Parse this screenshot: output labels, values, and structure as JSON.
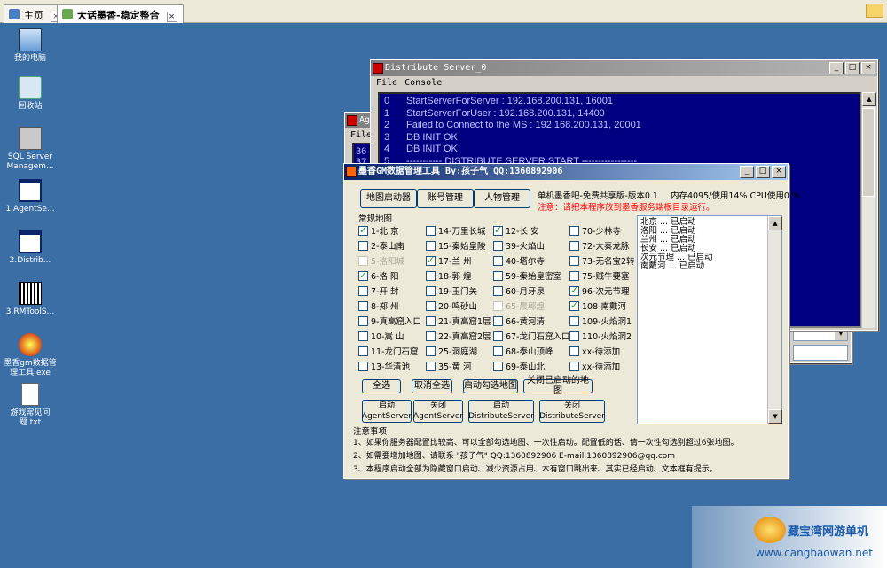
{
  "browser": {
    "tabs": [
      {
        "label": "主页"
      },
      {
        "label": "大话墨香-稳定整合"
      }
    ]
  },
  "desktop": {
    "icons": [
      {
        "label": "我的电脑"
      },
      {
        "label": "回收站"
      },
      {
        "label": "SQL Server Managem..."
      },
      {
        "label": "1.AgentSe..."
      },
      {
        "label": "2.Distrib..."
      },
      {
        "label": "3.RMToolS..."
      },
      {
        "label": "墨香gm数据管理工具.exe"
      },
      {
        "label": "游戏常见问题.txt"
      }
    ]
  },
  "distribute_window": {
    "title": "Distribute Server_0",
    "menu": [
      "File",
      "Console"
    ],
    "lines": [
      {
        "n": "0",
        "text": "StartServerForServer : 192.168.200.131, 16001"
      },
      {
        "n": "1",
        "text": "StartServerForUser : 192.168.200.131, 14400"
      },
      {
        "n": "2",
        "text": "Failed to Connect to the MS : 192.168.200.131, 20001"
      },
      {
        "n": "3",
        "text": "DB INIT OK"
      },
      {
        "n": "4",
        "text": "DB INIT OK"
      },
      {
        "n": "5",
        "text": "-----------   DISTRIBUTE SERVER START   -----------------"
      }
    ]
  },
  "agent_window": {
    "title": "Ag",
    "menu": [
      "File"
    ],
    "lines": [
      "36",
      "37"
    ]
  },
  "tool_window": {
    "title": "墨香GM数据管理工具 By:孩子气 QQ:1360892906",
    "top_buttons": [
      "地图启动器",
      "账号管理",
      "人物管理"
    ],
    "version": "单机墨香吧-免费共享版-版本0.1",
    "mem": "内存4095/使用14% CPU使用0 %",
    "notice": "注意：请把本程序放到墨香服务端根目录运行。",
    "group_label": "常规地图",
    "maps": [
      [
        {
          "label": "1-北 京",
          "checked": true
        },
        {
          "label": "14-万里长城",
          "checked": false
        },
        {
          "label": "12-长 安",
          "checked": true
        },
        {
          "label": "70-少林寺",
          "checked": false
        }
      ],
      [
        {
          "label": "2-泰山南",
          "checked": false
        },
        {
          "label": "15-秦始皇陵",
          "checked": false
        },
        {
          "label": "39-火焰山",
          "checked": false
        },
        {
          "label": "72-大秦龙脉",
          "checked": false
        }
      ],
      [
        {
          "label": "5-洛阳城",
          "checked": false,
          "disabled": true
        },
        {
          "label": "17-兰 州",
          "checked": true
        },
        {
          "label": "40-塔尔寺",
          "checked": false
        },
        {
          "label": "73-无名宝2转",
          "checked": false
        }
      ],
      [
        {
          "label": "6-洛 阳",
          "checked": true
        },
        {
          "label": "18-郭 煌",
          "checked": false
        },
        {
          "label": "59-秦始皇密室",
          "checked": false
        },
        {
          "label": "75-贼牛要塞",
          "checked": false
        }
      ],
      [
        {
          "label": "7-开 封",
          "checked": false
        },
        {
          "label": "19-玉门关",
          "checked": false
        },
        {
          "label": "60-月牙泉",
          "checked": false
        },
        {
          "label": "96-次元节理",
          "checked": true
        }
      ],
      [
        {
          "label": "8-郑 州",
          "checked": false
        },
        {
          "label": "20-鸣砂山",
          "checked": false
        },
        {
          "label": "65-晨郭煌",
          "checked": false,
          "disabled": true
        },
        {
          "label": "108-南戴河",
          "checked": true
        }
      ],
      [
        {
          "label": "9-真高窟入口",
          "checked": false
        },
        {
          "label": "21-真高窟1层",
          "checked": false
        },
        {
          "label": "66-黄河清",
          "checked": false
        },
        {
          "label": "109-火焰洞1",
          "checked": false
        }
      ],
      [
        {
          "label": "10-嵩 山",
          "checked": false
        },
        {
          "label": "22-真高窟2层",
          "checked": false
        },
        {
          "label": "67-龙门石窟入口",
          "checked": false
        },
        {
          "label": "110-火焰洞2",
          "checked": false
        }
      ],
      [
        {
          "label": "11-龙门石窟",
          "checked": false
        },
        {
          "label": "25-洞庭湖",
          "checked": false
        },
        {
          "label": "68-泰山顶峰",
          "checked": false
        },
        {
          "label": "xx-待添加",
          "checked": false
        }
      ],
      [
        {
          "label": "13-华清池",
          "checked": false
        },
        {
          "label": "35-黄 河",
          "checked": false
        },
        {
          "label": "69-泰山北",
          "checked": false
        },
        {
          "label": "xx-待添加",
          "checked": false
        }
      ]
    ],
    "action_buttons": [
      "全选",
      "取消全选",
      "启动勾选地图",
      "关闭已启动的地图"
    ],
    "server_buttons": [
      {
        "l1": "启动",
        "l2": "AgentServer"
      },
      {
        "l1": "关闭",
        "l2": "AgentServer"
      },
      {
        "l1": "启动",
        "l2": "DistributeServer"
      },
      {
        "l1": "关闭",
        "l2": "DistributeServer"
      }
    ],
    "status_lines": [
      "北京 ... 已启动",
      "洛阳 ... 已启动",
      "兰州 ... 已启动",
      "长安 ... 已启动",
      "次元节理 ... 已启动",
      "南戴河 ... 已启动"
    ],
    "notes_label": "注意事项",
    "notes": [
      "1、如果你服务器配置比较高、可以全部勾选地图、一次性启动。配置低的话、请一次性勾选别超过6张地图。",
      "2、如需要增加地图、请联系 \"孩子气\" QQ:1360892906 E-mail:1360892906@qq.com",
      "3、本程序启动全部为隐藏窗口启动、减少资源占用、木有窗口跳出来、其实已经启动、文本框有提示。"
    ]
  },
  "watermark": {
    "title": "藏宝湾网游单机",
    "url": "www.cangbaowan.net"
  },
  "colors": {
    "desktop": "#3a6ea5",
    "console_bg": "#000080",
    "notice": "#ff0000"
  }
}
